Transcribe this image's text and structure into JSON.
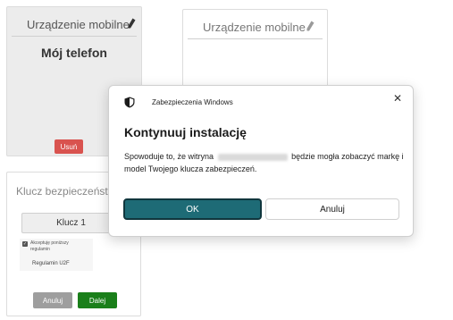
{
  "device_cards": [
    {
      "title": "Urządzenie mobilne",
      "device_name": "Mój telefon",
      "remove_label": "Usuń"
    },
    {
      "title": "Urządzenie mobilne"
    }
  ],
  "security_key_card": {
    "title": "Klucz bezpieczeństwa",
    "selected_key": "Klucz 1",
    "terms_checked": true,
    "terms_text": "Akceptuję poniższy regulamin",
    "regulation_link": "Regulamin U2F",
    "cancel_label": "Anuluj",
    "next_label": "Dalej"
  },
  "dialog": {
    "caption": "Zabezpieczenia Windows",
    "close_glyph": "✕",
    "heading": "Kontynuuj instalację",
    "body_prefix": "Spowoduje to, że witryna",
    "body_suffix": "będzie mogła zobaczyć markę i model Twojego klucza zabezpieczeń.",
    "ok_label": "OK",
    "cancel_label": "Anuluj"
  },
  "colors": {
    "remove_button": "#d9534f",
    "next_button": "#1a7f1a",
    "ok_button": "#1e6b76"
  },
  "icons": [
    "pencil-icon",
    "shield-icon",
    "close-icon",
    "checkbox-checked-icon"
  ]
}
